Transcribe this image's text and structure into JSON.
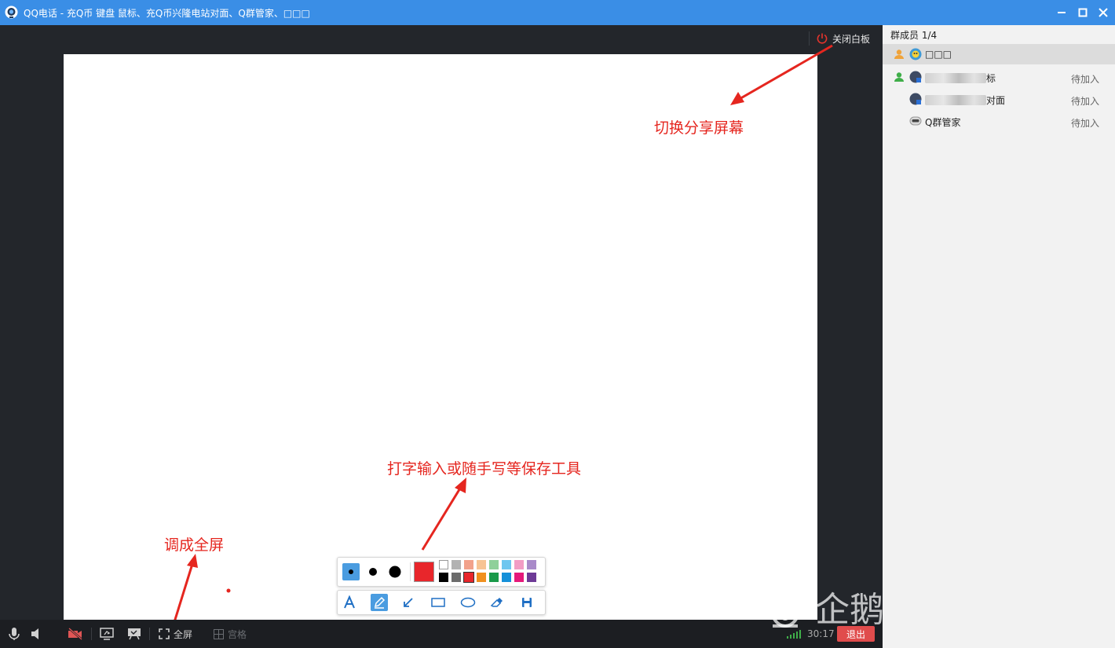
{
  "window": {
    "title": "QQ电话 - 充Q币 键盘 鼠标、充Q币兴隆电站对面、Q群管家、□□□",
    "minimize_icon": "minimize-icon",
    "maximize_icon": "maximize-icon",
    "close_icon": "close-icon"
  },
  "stage": {
    "close_whiteboard_label": "关闭白板",
    "annotations": {
      "switch_share": "切换分享屏幕",
      "tools": "打字输入或随手写等保存工具",
      "fullscreen": "调成全屏"
    }
  },
  "whiteboard_toolbar": {
    "pen_sizes": [
      "small",
      "medium",
      "large"
    ],
    "selected_color": "#e8262b",
    "palette_top": [
      "#ffffff",
      "#b2b2b2",
      "#f2a28b",
      "#f7c494",
      "#8fd09a",
      "#6ec6ef",
      "#f29cc4",
      "#a98ac9"
    ],
    "palette_bottom": [
      "#000000",
      "#6b6b6b",
      "#e8262b",
      "#f0901f",
      "#1a9a4a",
      "#1590d9",
      "#e5197a",
      "#6d3a96"
    ],
    "tools": [
      "text-icon",
      "pencil-icon",
      "arrow-icon",
      "rectangle-icon",
      "ellipse-icon",
      "eraser-icon",
      "save-icon"
    ]
  },
  "bottombar": {
    "fullscreen_label": "全屏",
    "grid_label": "宫格",
    "timer": "30:17",
    "exit_label": "退出"
  },
  "sidebar": {
    "title": "群成员 1/4",
    "members": [
      {
        "name": "□□□",
        "status": ""
      },
      {
        "name": "标",
        "status": "待加入"
      },
      {
        "name": "对面",
        "status": "待加入"
      },
      {
        "name": "Q群管家",
        "status": "待加入"
      }
    ]
  },
  "watermark": {
    "text": "企鹅号 逆行向上"
  }
}
